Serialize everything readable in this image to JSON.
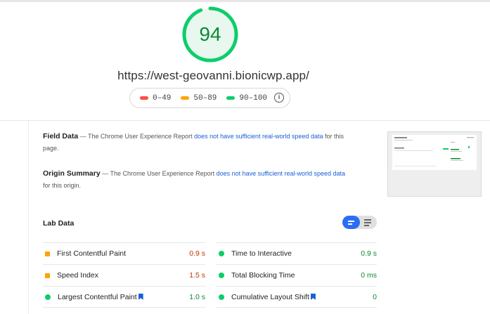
{
  "score": {
    "value": "94",
    "fraction": 0.94,
    "color": "#0cce6b",
    "text_color": "#0a8a36"
  },
  "url": "https://west-geovanni.bionicwp.app/",
  "legend": {
    "items": [
      {
        "label": "0–49",
        "color": "#ff4e42"
      },
      {
        "label": "50–89",
        "color": "#ffa400"
      },
      {
        "label": "90–100",
        "color": "#0cce6b"
      }
    ],
    "info_icon": "info-icon"
  },
  "field_data": {
    "title": "Field Data",
    "dash": " — ",
    "prefix": "The Chrome User Experience Report ",
    "link": "does not have sufficient real-world speed data",
    "suffix": " for this page."
  },
  "origin_summary": {
    "title": "Origin Summary",
    "dash": " — ",
    "prefix": "The Chrome User Experience Report ",
    "link": "does not have sufficient real-world speed data",
    "suffix": " for this origin."
  },
  "lab_data": {
    "title": "Lab Data",
    "metrics_left": [
      {
        "label": "First Contentful Paint",
        "value": "0.9 s",
        "marker": "square",
        "color": "#ffa400",
        "value_color": "#c33300",
        "flag": false
      },
      {
        "label": "Speed Index",
        "value": "1.5 s",
        "marker": "square",
        "color": "#ffa400",
        "value_color": "#c33300",
        "flag": false
      },
      {
        "label": "Largest Contentful Paint",
        "value": "1.0 s",
        "marker": "circle",
        "color": "#0cce6b",
        "value_color": "#0a8a36",
        "flag": true
      }
    ],
    "metrics_right": [
      {
        "label": "Time to Interactive",
        "value": "0.9 s",
        "marker": "circle",
        "color": "#0cce6b",
        "value_color": "#0a8a36",
        "flag": false
      },
      {
        "label": "Total Blocking Time",
        "value": "0 ms",
        "marker": "circle",
        "color": "#0cce6b",
        "value_color": "#0a8a36",
        "flag": false
      },
      {
        "label": "Cumulative Layout Shift",
        "value": "0",
        "marker": "circle",
        "color": "#0cce6b",
        "value_color": "#0a8a36",
        "flag": true
      }
    ]
  }
}
